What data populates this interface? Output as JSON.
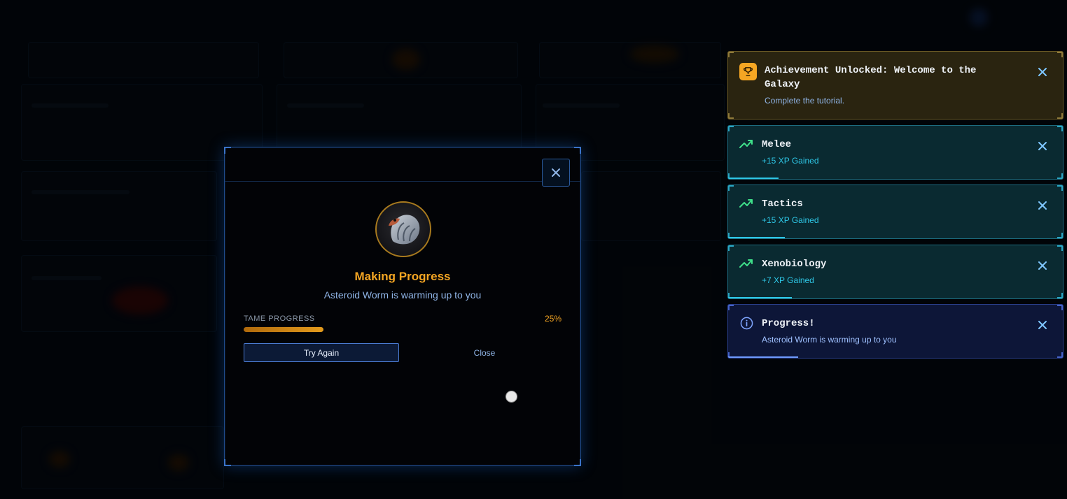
{
  "modal": {
    "result_title": "Making Progress",
    "result_subtitle": "Asteroid Worm is warming up to you",
    "progress_label": "TAME PROGRESS",
    "progress_percent_text": "25%",
    "progress_fraction": 0.25,
    "try_again_label": "Try Again",
    "close_label": "Close",
    "creature_icon": "asteroid-worm-portrait"
  },
  "notifications": [
    {
      "kind": "achievement",
      "icon": "trophy-icon",
      "title": "Achievement Unlocked: Welcome to the Galaxy",
      "subtitle": "Complete the tutorial.",
      "color": "#f5a623"
    },
    {
      "kind": "skill",
      "icon": "trending-up-icon",
      "title": "Melee",
      "subtitle": "+15 XP Gained",
      "color": "#2ec7e6",
      "timer_fraction": 0.15
    },
    {
      "kind": "skill",
      "icon": "trending-up-icon",
      "title": "Tactics",
      "subtitle": "+15 XP Gained",
      "color": "#2ec7e6",
      "timer_fraction": 0.17
    },
    {
      "kind": "skill",
      "icon": "trending-up-icon",
      "title": "Xenobiology",
      "subtitle": "+7 XP Gained",
      "color": "#2ec7e6",
      "timer_fraction": 0.19
    },
    {
      "kind": "info",
      "icon": "info-icon",
      "title": "Progress!",
      "subtitle": "Asteroid Worm is warming up to you",
      "color": "#6f9bff",
      "timer_fraction": 0.21
    }
  ]
}
